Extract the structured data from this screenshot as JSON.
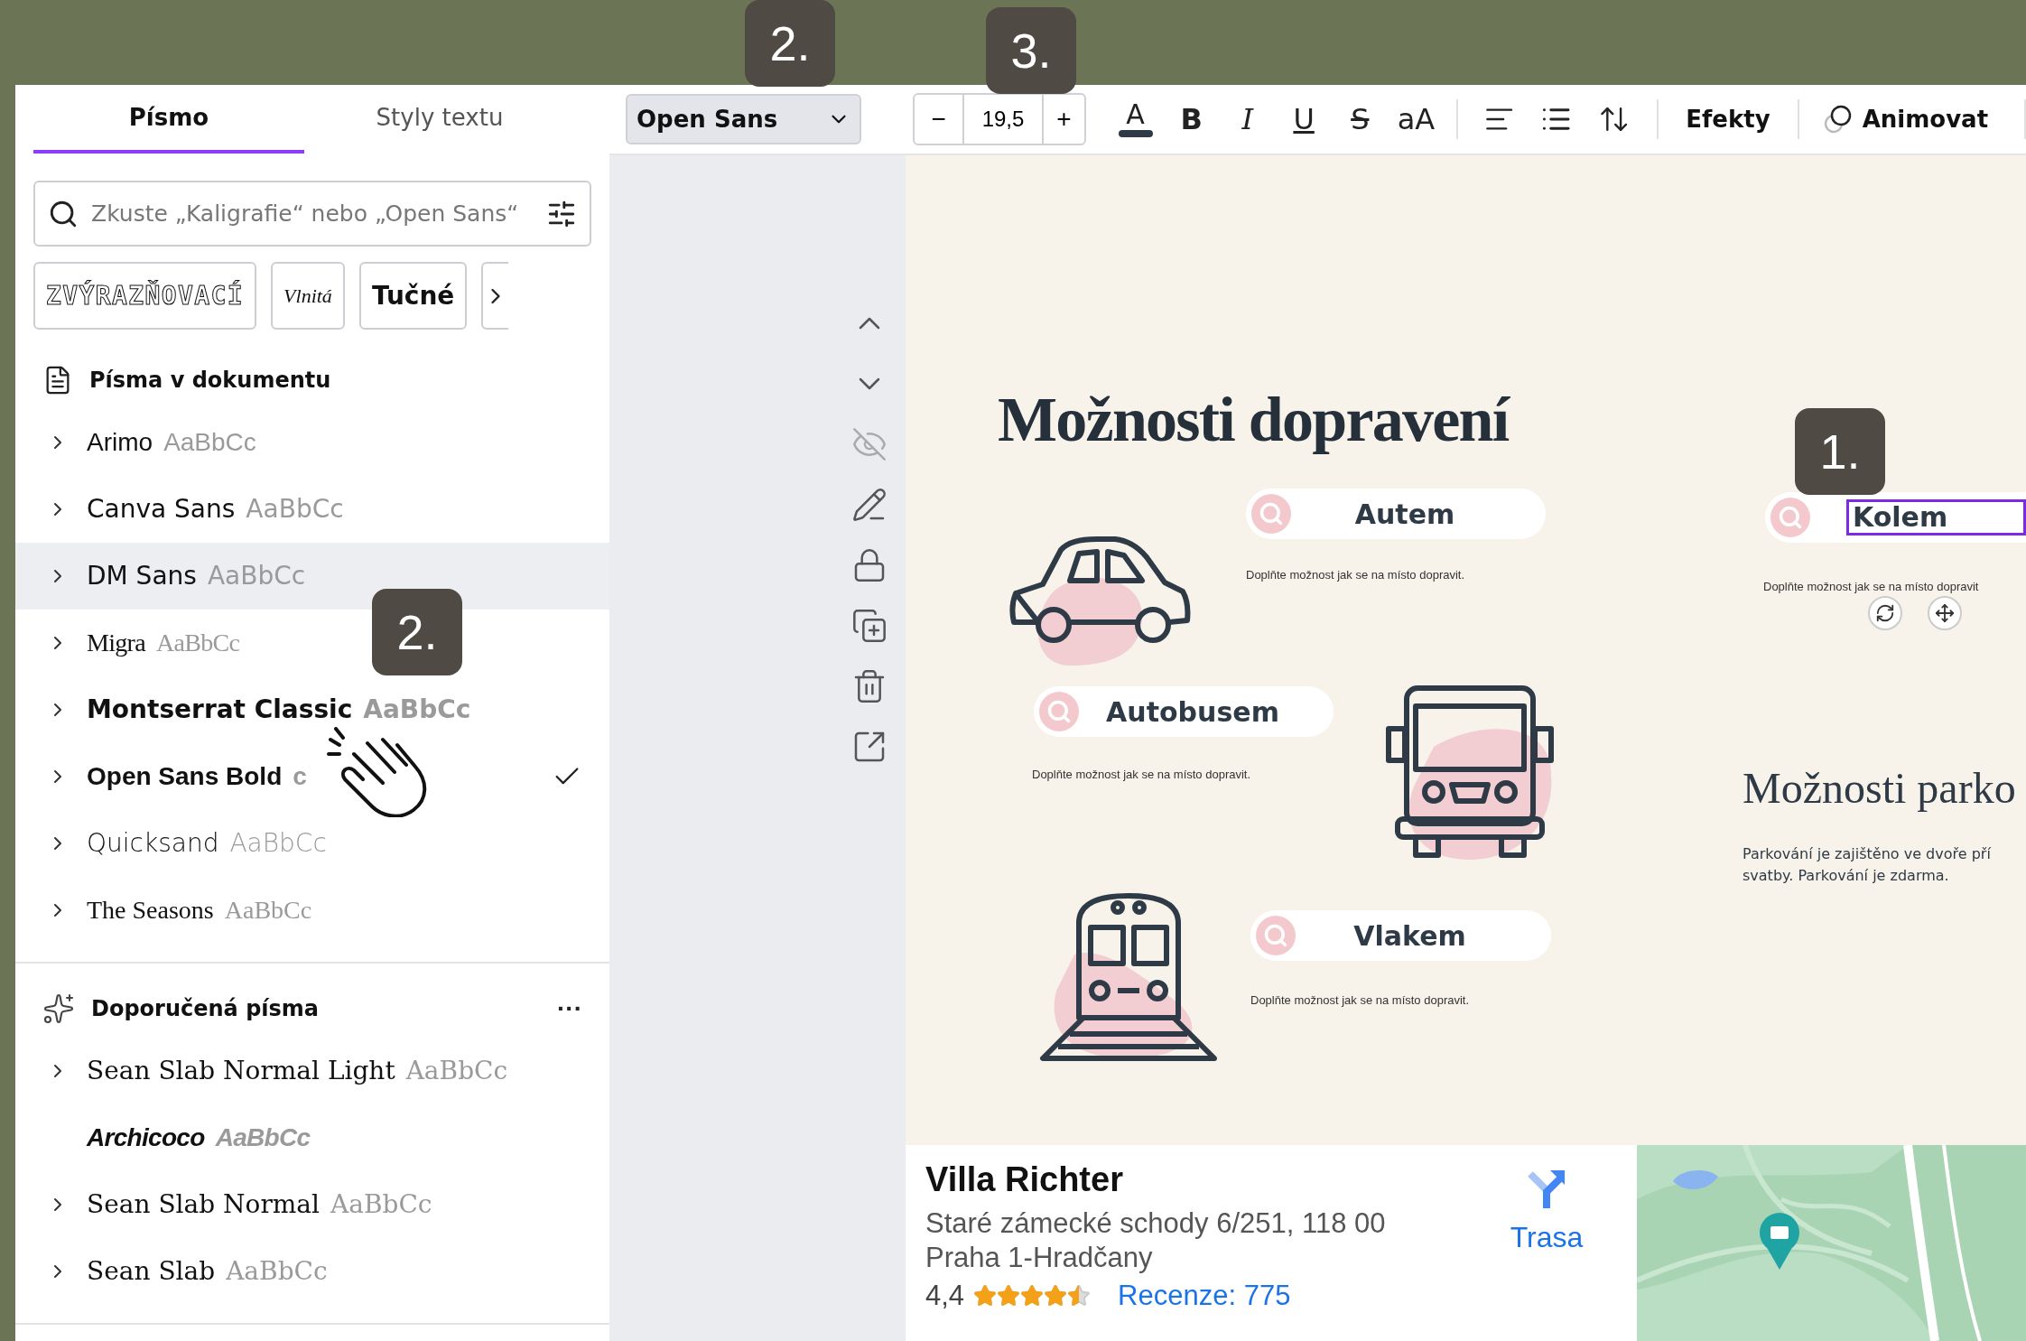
{
  "step_badges": [
    "2.",
    "3.",
    "1.",
    "2."
  ],
  "panel": {
    "tabs": [
      {
        "label": "Písmo",
        "selected": true
      },
      {
        "label": "Styly textu",
        "selected": false
      }
    ],
    "search": {
      "placeholder": "Zkuste „Kaligrafie“ nebo „Open Sans“"
    },
    "style_chips": [
      "ZVÝRAZŇOVACÍ",
      "Vlnitá",
      "Tučné"
    ],
    "sections": [
      {
        "title": "Písma v dokumentu",
        "kind": "document",
        "items": [
          {
            "name": "Arimo",
            "sample": "AaBbCc",
            "expandable": true,
            "highlighted": false,
            "selected": false
          },
          {
            "name": "Canva Sans",
            "sample": "AaBbCc",
            "expandable": true,
            "highlighted": false,
            "selected": false
          },
          {
            "name": "DM Sans",
            "sample": "AaBbCc",
            "expandable": true,
            "highlighted": true,
            "selected": false
          },
          {
            "name": "Migra",
            "sample": "AaBbCc",
            "expandable": true,
            "highlighted": false,
            "selected": false
          },
          {
            "name": "Montserrat Classic",
            "sample": "AaBbCc",
            "expandable": true,
            "highlighted": false,
            "selected": false
          },
          {
            "name": "Open Sans Bold",
            "sample": "c",
            "expandable": true,
            "highlighted": false,
            "selected": true
          },
          {
            "name": "Quicksand",
            "sample": "AaBbCc",
            "expandable": true,
            "highlighted": false,
            "selected": false
          },
          {
            "name": "The Seasons",
            "sample": "AaBbCc",
            "expandable": true,
            "highlighted": false,
            "selected": false
          }
        ]
      },
      {
        "title": "Doporučená písma",
        "kind": "recommended",
        "more": "···",
        "items": [
          {
            "name": "Sean Slab Normal Light",
            "sample": "AaBbCc",
            "expandable": true,
            "highlighted": false,
            "selected": false
          },
          {
            "name": "Archicoco",
            "sample": "AaBbCc",
            "expandable": false,
            "highlighted": false,
            "selected": false
          },
          {
            "name": "Sean Slab Normal",
            "sample": "AaBbCc",
            "expandable": true,
            "highlighted": false,
            "selected": false
          },
          {
            "name": "Sean Slab",
            "sample": "AaBbCc",
            "expandable": true,
            "highlighted": false,
            "selected": false
          }
        ]
      }
    ]
  },
  "toolbar": {
    "font": "Open Sans",
    "minus": "−",
    "size": "19,5",
    "plus": "+",
    "text_color": "A",
    "format": [
      "B",
      "I",
      "U",
      "S",
      "aA"
    ],
    "effects": "Efekty",
    "animate": "Animovat"
  },
  "canvas": {
    "title": "Možnosti dopravení",
    "options": [
      {
        "label": "Autem",
        "description": "Doplňte možnost jak se na místo dopravit.",
        "selected": false
      },
      {
        "label": "Autobusem",
        "description": "Doplňte možnost jak se na místo dopravit.",
        "selected": false
      },
      {
        "label": "Vlakem",
        "description": "Doplňte možnost jak se na místo dopravit.",
        "selected": false
      },
      {
        "label": "Kolem",
        "description": "Doplňte možnost jak se na místo dopravit",
        "selected": true
      }
    ],
    "parking": {
      "title": "Možnosti parko",
      "lines": [
        "Parkování je zajištěno ve dvoře pří",
        "svatby. Parkování je zdarma."
      ]
    }
  },
  "map_card": {
    "name": "Villa Richter",
    "address": [
      "Staré zámecké schody 6/251, 118 00",
      "Praha 1-Hradčany"
    ],
    "directions": "Trasa",
    "rating": "4,4",
    "stars": 4.5,
    "reviews": "Recenze: 775"
  }
}
